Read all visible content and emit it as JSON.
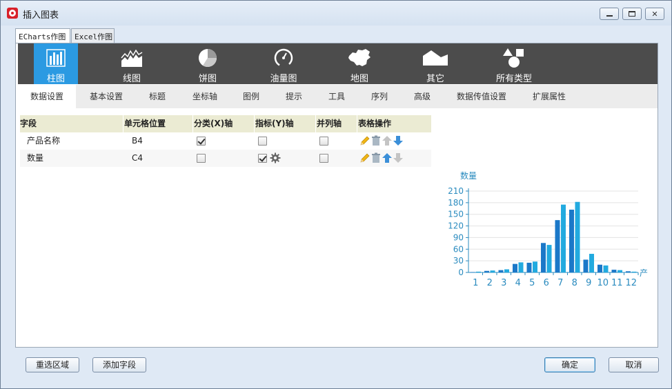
{
  "window": {
    "title": "插入图表"
  },
  "top_tabs": [
    {
      "label": "ECharts作图",
      "active": true
    },
    {
      "label": "Excel作图",
      "active": false
    }
  ],
  "chart_types": [
    {
      "label": "柱图",
      "icon": "bar-chart-icon",
      "active": true
    },
    {
      "label": "线图",
      "icon": "area-chart-icon",
      "active": false
    },
    {
      "label": "饼图",
      "icon": "pie-chart-icon",
      "active": false
    },
    {
      "label": "油量图",
      "icon": "gauge-icon",
      "active": false
    },
    {
      "label": "地图",
      "icon": "china-map-icon",
      "active": false
    },
    {
      "label": "其它",
      "icon": "mountain-icon",
      "active": false
    },
    {
      "label": "所有类型",
      "icon": "shapes-icon",
      "active": false
    }
  ],
  "sub_tabs": [
    {
      "label": "数据设置",
      "active": true
    },
    {
      "label": "基本设置"
    },
    {
      "label": "标题"
    },
    {
      "label": "坐标轴"
    },
    {
      "label": "图例"
    },
    {
      "label": "提示"
    },
    {
      "label": "工具"
    },
    {
      "label": "序列"
    },
    {
      "label": "高级"
    },
    {
      "label": "数据传值设置"
    },
    {
      "label": "扩展属性"
    }
  ],
  "field_table": {
    "headers": [
      "字段",
      "单元格位置",
      "分类(X)轴",
      "指标(Y)轴",
      "并列轴",
      "表格操作"
    ],
    "rows": [
      {
        "field": "产品名称",
        "cell": "B4",
        "x_axis": true,
        "y_axis": false,
        "parallel": false
      },
      {
        "field": "数量",
        "cell": "C4",
        "x_axis": false,
        "y_axis": true,
        "parallel": false
      }
    ]
  },
  "chart_data": {
    "type": "bar",
    "title": "数量",
    "xlabel": "产",
    "ylabel": "",
    "ylim": [
      0,
      210
    ],
    "yticks": [
      0,
      30,
      60,
      90,
      120,
      150,
      180,
      210
    ],
    "categories": [
      "1",
      "2",
      "3",
      "4",
      "5",
      "6",
      "7",
      "8",
      "9",
      "10",
      "11",
      "12"
    ],
    "series": [
      {
        "values": [
          1,
          4,
          6,
          22,
          25,
          76,
          135,
          162,
          33,
          20,
          7,
          3
        ]
      },
      {
        "values": [
          2,
          5,
          8,
          26,
          28,
          71,
          175,
          182,
          48,
          18,
          6,
          2
        ]
      }
    ],
    "colors": [
      "#1b78c8",
      "#22aadf"
    ],
    "grid": true
  },
  "footer": {
    "reselect": "重选区域",
    "add_field": "添加字段",
    "ok": "确定",
    "cancel": "取消"
  }
}
